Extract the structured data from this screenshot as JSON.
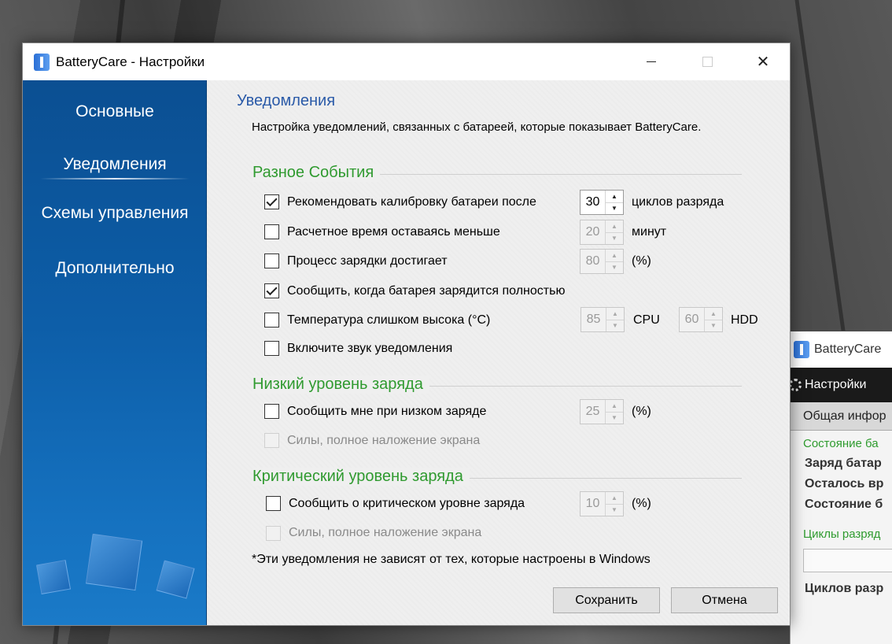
{
  "window": {
    "title": "BatteryCare - Настройки"
  },
  "sidebar": {
    "items": [
      {
        "label": "Основные"
      },
      {
        "label": "Уведомления"
      },
      {
        "label": "Схемы управления"
      },
      {
        "label": "Дополнительно"
      }
    ]
  },
  "pane": {
    "title": "Уведомления",
    "description": "Настройка уведомлений, связанных с батареей, которые показывает BatteryCare."
  },
  "groups": {
    "misc": {
      "title": "Разное События",
      "calibrate": {
        "label": "Рекомендовать калибровку батареи после",
        "checked": true,
        "value": "30",
        "unit": "циклов разряда"
      },
      "remaining": {
        "label": "Расчетное время оставаясь меньше",
        "checked": false,
        "value": "20",
        "unit": "минут"
      },
      "charging": {
        "label": "Процесс зарядки достигает",
        "checked": false,
        "value": "80",
        "unit": "(%)"
      },
      "full": {
        "label": "Сообщить, когда батарея зарядится полностью",
        "checked": true
      },
      "temperature": {
        "label": "Температура слишком высока (°C)",
        "checked": false,
        "cpu_value": "85",
        "cpu_unit": "CPU",
        "hdd_value": "60",
        "hdd_unit": "HDD"
      },
      "sound": {
        "label": "Включите звук уведомления",
        "checked": false
      }
    },
    "low": {
      "title": "Низкий уровень заряда",
      "notify": {
        "label": "Сообщить мне при низком заряде",
        "checked": false,
        "value": "25",
        "unit": "(%)"
      },
      "overlay": {
        "label": "Силы, полное наложение экрана",
        "checked": false
      }
    },
    "critical": {
      "title": "Критический уровень заряда",
      "notify": {
        "label": "Сообщить о критическом уровне заряда",
        "checked": false,
        "value": "10",
        "unit": "(%)"
      },
      "overlay": {
        "label": "Силы, полное наложение экрана",
        "checked": false
      }
    }
  },
  "note": "*Эти уведомления не зависят от тех, которые настроены в Windows",
  "buttons": {
    "save": "Сохранить",
    "cancel": "Отмена"
  },
  "bg_window": {
    "title": "BatteryCare",
    "toolbar": "Настройки",
    "tab": "Общая инфор",
    "section1": "Состояние ба",
    "rows": [
      "Заряд батар",
      "Осталось вр",
      "Состояние б"
    ],
    "section2": "Циклы разряд",
    "cycles": "Циклов разр"
  }
}
